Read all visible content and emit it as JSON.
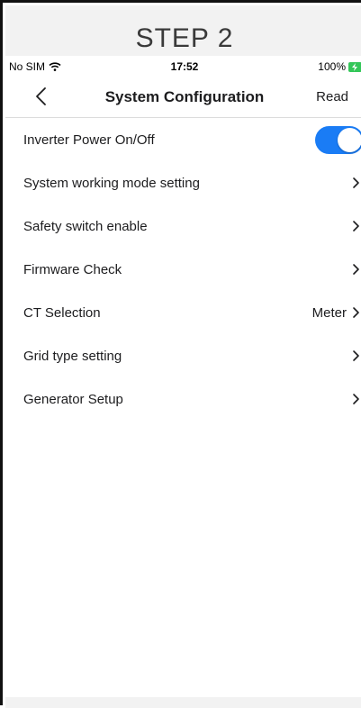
{
  "banner": {
    "title": "STEP 2"
  },
  "status_bar": {
    "carrier": "No SIM",
    "time": "17:52",
    "battery": "100%"
  },
  "nav": {
    "title": "System Configuration",
    "action_label": "Read"
  },
  "settings": {
    "items": [
      {
        "label": "Inverter Power On/Off",
        "type": "toggle",
        "toggle_on": true
      },
      {
        "label": "System working mode setting",
        "type": "link"
      },
      {
        "label": "Safety switch enable",
        "type": "link"
      },
      {
        "label": "Firmware Check",
        "type": "link"
      },
      {
        "label": "CT Selection",
        "type": "link",
        "value": "Meter"
      },
      {
        "label": "Grid type setting",
        "type": "link"
      },
      {
        "label": "Generator Setup",
        "type": "link"
      }
    ]
  },
  "colors": {
    "accent": "#1a7cf5",
    "battery": "#34c759"
  }
}
